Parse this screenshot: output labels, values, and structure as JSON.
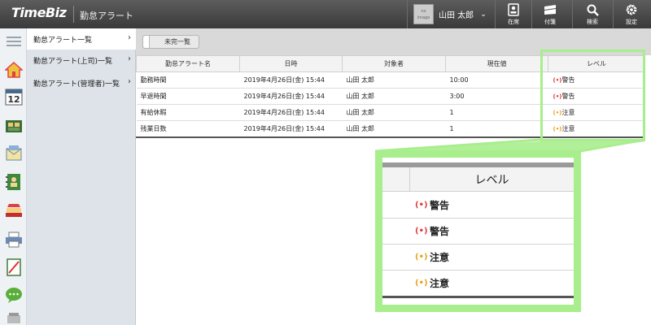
{
  "header": {
    "logo": "TimeBiz",
    "app_title": "勤怠アラート",
    "avatar_text": "no image",
    "user_name": "山田 太郎",
    "buttons": [
      {
        "label": "在席",
        "icon": "id-card-icon"
      },
      {
        "label": "付箋",
        "icon": "sticky-note-icon"
      },
      {
        "label": "検索",
        "icon": "search-icon"
      },
      {
        "label": "設定",
        "icon": "gear-icon"
      }
    ]
  },
  "rail": {
    "items": [
      "menu-icon",
      "home-icon",
      "calendar-icon",
      "facility-icon",
      "mail-icon",
      "addressbook-icon",
      "timecard-icon",
      "printer-icon",
      "report-icon",
      "chat-icon",
      "more-icon"
    ],
    "calendar_day": "12"
  },
  "submenu": {
    "items": [
      {
        "label": "勤怠アラート一覧",
        "active": true
      },
      {
        "label": "勤怠アラート(上司)一覧",
        "active": false
      },
      {
        "label": "勤怠アラート(管理者)一覧",
        "active": false
      }
    ]
  },
  "toolbar": {
    "toggle_label": "未完一覧"
  },
  "table": {
    "columns": [
      "勤怠アラート名",
      "日時",
      "対象者",
      "現在値",
      "レベル"
    ],
    "rows": [
      {
        "name": "勤務時間",
        "datetime": "2019年4月26日(金) 15:44",
        "person": "山田 太郎",
        "value": "10:00",
        "level": "警告",
        "level_icon": "(•)",
        "level_color": "#e23a3a"
      },
      {
        "name": "早退時間",
        "datetime": "2019年4月26日(金) 15:44",
        "person": "山田 太郎",
        "value": "3:00",
        "level": "警告",
        "level_icon": "(•)",
        "level_color": "#e23a3a"
      },
      {
        "name": "有給休暇",
        "datetime": "2019年4月26日(金) 15:44",
        "person": "山田 太郎",
        "value": "1",
        "level": "注意",
        "level_icon": "(•)",
        "level_color": "#e8a21c"
      },
      {
        "name": "残業日数",
        "datetime": "2019年4月26日(金) 15:44",
        "person": "山田 太郎",
        "value": "1",
        "level": "注意",
        "level_icon": "(•)",
        "level_color": "#e8a21c"
      }
    ]
  },
  "zoom": {
    "header": "レベル",
    "rows": [
      {
        "level": "警告",
        "color": "#e23a3a"
      },
      {
        "level": "警告",
        "color": "#e23a3a"
      },
      {
        "level": "注意",
        "color": "#e8a21c"
      },
      {
        "level": "注意",
        "color": "#e8a21c"
      }
    ],
    "icon": "(•)",
    "highlight_color": "#a8ee8d"
  }
}
